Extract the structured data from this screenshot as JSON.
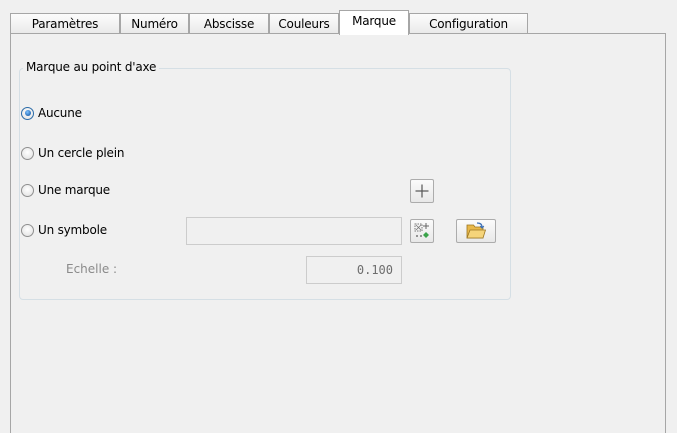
{
  "tabs": [
    {
      "label": "Paramètres",
      "active": false
    },
    {
      "label": "Numéro",
      "active": false
    },
    {
      "label": "Abscisse",
      "active": false
    },
    {
      "label": "Couleurs",
      "active": false
    },
    {
      "label": "Marque",
      "active": true
    },
    {
      "label": "Configuration",
      "active": false
    }
  ],
  "group": {
    "title": "Marque au point d'axe",
    "options": [
      {
        "label": "Aucune",
        "checked": true
      },
      {
        "label": "Un cercle plein",
        "checked": false
      },
      {
        "label": "Une marque",
        "checked": false
      },
      {
        "label": "Un symbole",
        "checked": false
      }
    ],
    "symbol_value": "",
    "scale_label": "Echelle :",
    "scale_value": "0.100"
  },
  "icons": {
    "add_mark": "plus-icon",
    "symbol_picker": "symbol-grid-icon",
    "open": "open-folder-icon"
  },
  "colors": {
    "accent": "#1a5fae",
    "folder": "#e8b84a",
    "symbol_dot": "#3aa34a"
  }
}
